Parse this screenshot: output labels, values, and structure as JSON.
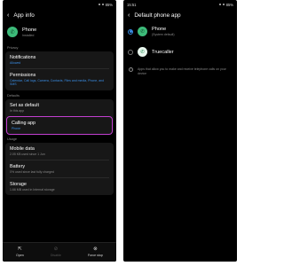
{
  "left": {
    "status": {
      "time": "",
      "battery": "85%"
    },
    "title": "App info",
    "app": {
      "name": "Phone",
      "status": "Installed"
    },
    "sections": {
      "privacy": "Privacy",
      "defaults": "Defaults",
      "usage": "Usage"
    },
    "rows": {
      "notifications": {
        "title": "Notifications",
        "sub": "Allowed"
      },
      "permissions": {
        "title": "Permissions",
        "sub": "Calendar, Call logs, Camera, Contacts, Files and media, Phone, and SMS"
      },
      "set_default": {
        "title": "Set as default",
        "sub": "In this app"
      },
      "calling_app": {
        "title": "Calling app",
        "sub": "Phone"
      },
      "mobile_data": {
        "title": "Mobile data",
        "sub": "2.05 KB used since 1 Jun"
      },
      "battery": {
        "title": "Battery",
        "sub": "0% used since last fully charged"
      },
      "storage": {
        "title": "Storage",
        "sub": "1.66 MB used in Internal storage"
      }
    },
    "bottom": {
      "open": "Open",
      "disable": "Disable",
      "force_stop": "Force stop"
    }
  },
  "right": {
    "status": {
      "time": "15:51",
      "battery": "85%"
    },
    "title": "Default phone app",
    "options": [
      {
        "name": "Phone",
        "sub": "(System default)",
        "selected": true
      },
      {
        "name": "Truecaller",
        "sub": "",
        "selected": false
      }
    ],
    "info": "Apps that allow you to make and receive telephone calls on your device"
  },
  "colors": {
    "accent": "#3a8ee6",
    "highlight": "#c23fd0",
    "phone_icon": "#3dbb7a"
  }
}
